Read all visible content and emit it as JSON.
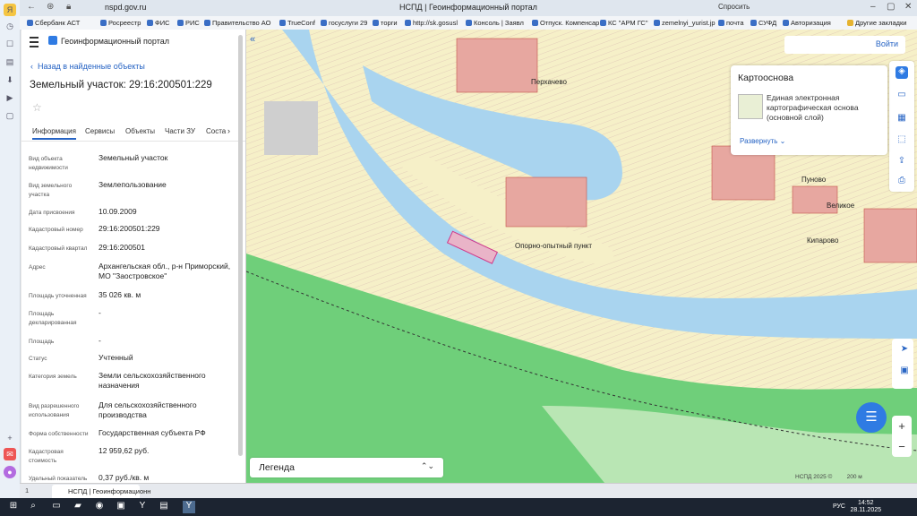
{
  "browser": {
    "url": "nspd.gov.ru",
    "window_title": "НСПД | Геоинформационный портал",
    "ask_label": "Спросить",
    "bookmarks": [
      "Сбербанк АСТ",
      "Росреестр",
      "ФИС",
      "РИС",
      "Правительство АО",
      "TrueConf",
      "госуслуги 29",
      "торги",
      "http://sk.gosusl",
      "Консоль | Заявл",
      "Отпуск. Компенсар",
      "КС \"АРМ ГС\"",
      "zemelnyi_yurist.jp",
      "почта",
      "СУФД",
      "Авторизация",
      "Другие закладки"
    ],
    "tab_count": "1",
    "tab_title": "НСПД | Геоинформационн"
  },
  "portal": {
    "name": "Геоинформационный портал",
    "back_link": "Назад в найденные объекты",
    "object_title": "Земельный участок: 29:16:200501:229",
    "tabs": [
      "Информация",
      "Сервисы",
      "Объекты",
      "Части ЗУ",
      "Соста"
    ],
    "rows": [
      {
        "label": "Вид объекта недвижимости",
        "value": "Земельный участок"
      },
      {
        "label": "Вид земельного участка",
        "value": "Землепользование"
      },
      {
        "label": "Дата присвоения",
        "value": "10.09.2009"
      },
      {
        "label": "Кадастровый номер",
        "value": "29:16:200501:229"
      },
      {
        "label": "Кадастровый квартал",
        "value": "29:16:200501"
      },
      {
        "label": "Адрес",
        "value": "Архангельская обл., р-н Приморский, МО \"Заостровское\""
      },
      {
        "label": "Площадь уточненная",
        "value": "35 026 кв. м"
      },
      {
        "label": "Площадь декларированная",
        "value": "-"
      },
      {
        "label": "Площадь",
        "value": "-"
      },
      {
        "label": "Статус",
        "value": "Учтенный"
      },
      {
        "label": "Категория земель",
        "value": "Земли сельскохозяйственного назначения"
      },
      {
        "label": "Вид разрешенного использования",
        "value": "Для сельскохозяйственного производства"
      },
      {
        "label": "Форма собственности",
        "value": "Государственная субъекта РФ"
      },
      {
        "label": "Кадастровая стоимость",
        "value": "12 959,62 руб."
      },
      {
        "label": "Удельный показатель",
        "value": "0,37 руб./кв. м"
      }
    ]
  },
  "map": {
    "login": "Войти",
    "basemap_title": "Картооснова",
    "basemap_desc": "Единая электронная картографическая основа (основной слой)",
    "expand": "Развернуть",
    "legend": "Легенда",
    "credits": "НСПД 2025 ©",
    "scale": "200 м",
    "places": [
      "Перхачево",
      "Опорно-опытный пункт",
      "Великое",
      "Кипарово",
      "Пуново"
    ]
  },
  "taskbar": {
    "time": "14:52",
    "date": "28.11.2025",
    "lang": "РУС"
  }
}
